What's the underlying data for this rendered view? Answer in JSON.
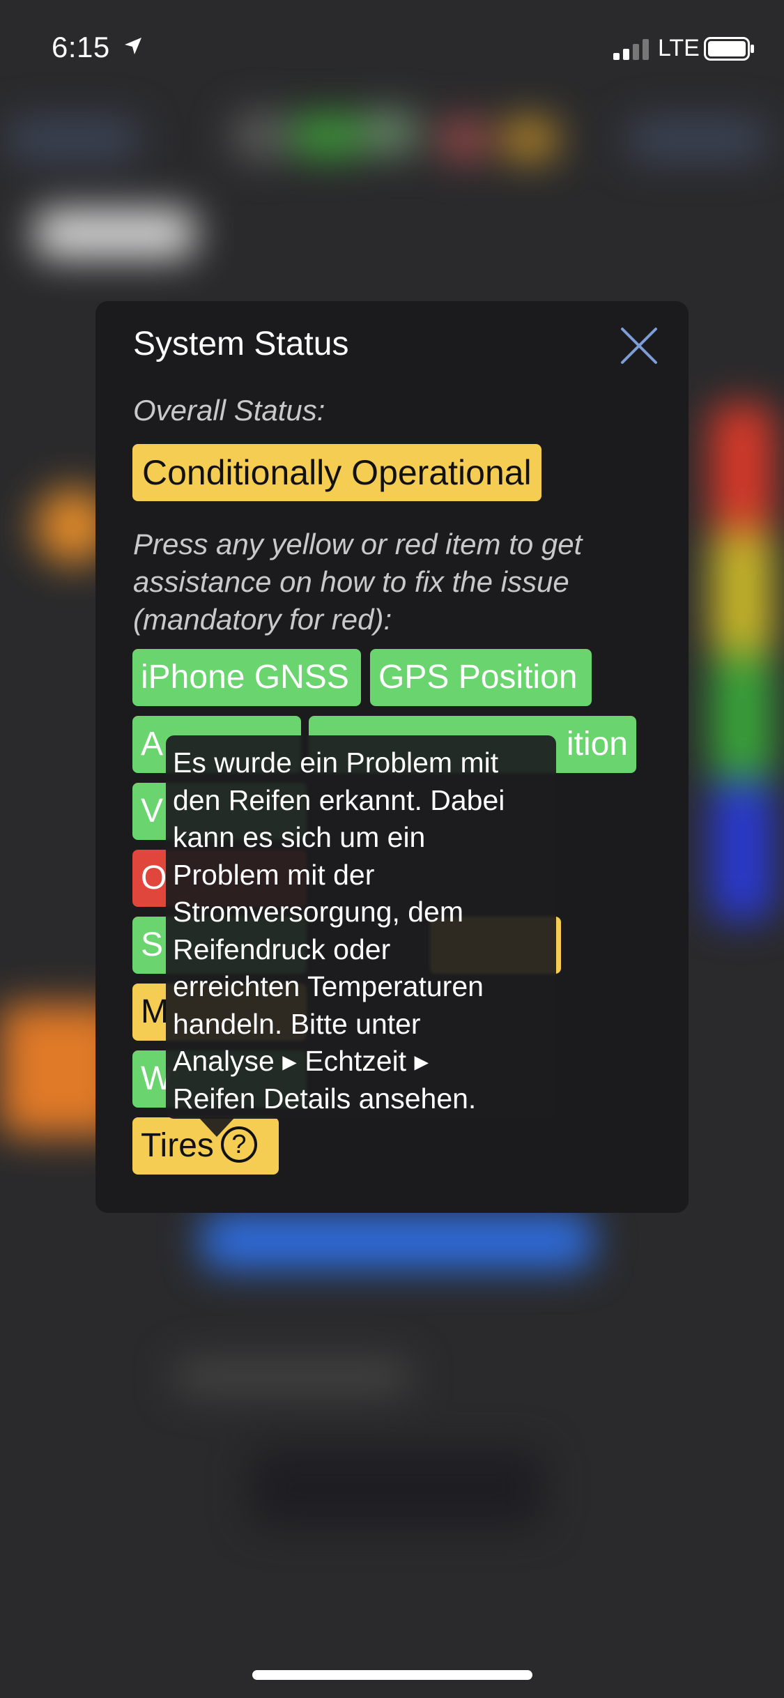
{
  "status_bar": {
    "time": "6:15",
    "network": "LTE",
    "icons": [
      "location-arrow-icon",
      "cellular-signal-icon",
      "battery-icon"
    ]
  },
  "modal": {
    "title": "System Status",
    "close_icon": "close-x-icon",
    "overall_label": "Overall Status:",
    "overall_value": "Conditionally Operational",
    "help_text": "Press any yellow or red item to get assistance on how to fix the issue (mandatory for red):",
    "items": [
      {
        "label": "iPhone GNSS",
        "status": "green"
      },
      {
        "label": "GPS Position",
        "status": "green"
      },
      {
        "label": "A",
        "status": "green"
      },
      {
        "label": "ition",
        "status": "green"
      },
      {
        "label": "V",
        "status": "green"
      },
      {
        "label": "O",
        "status": "red"
      },
      {
        "label": "S",
        "status": "green"
      },
      {
        "label": "M",
        "status": "yellow"
      },
      {
        "label": "W",
        "status": "green"
      },
      {
        "label": "Tires",
        "status": "yellow",
        "help_icon": "question-circle-icon"
      }
    ],
    "tooltip_lines": [
      "Es wurde ein Problem mit",
      "den Reifen erkannt. Dabei",
      "kann es sich um ein",
      "Problem mit der",
      "Stromversorgung, dem",
      "Reifendruck oder",
      "erreichten Temperaturen",
      "handeln. Bitte unter",
      "Analyse ▸ Echtzeit ▸",
      "Reifen Details ansehen."
    ]
  },
  "colors": {
    "green": "#6ad46f",
    "yellow": "#f5cd52",
    "red": "#e0463c",
    "modal_bg": "#1b1b1d"
  }
}
